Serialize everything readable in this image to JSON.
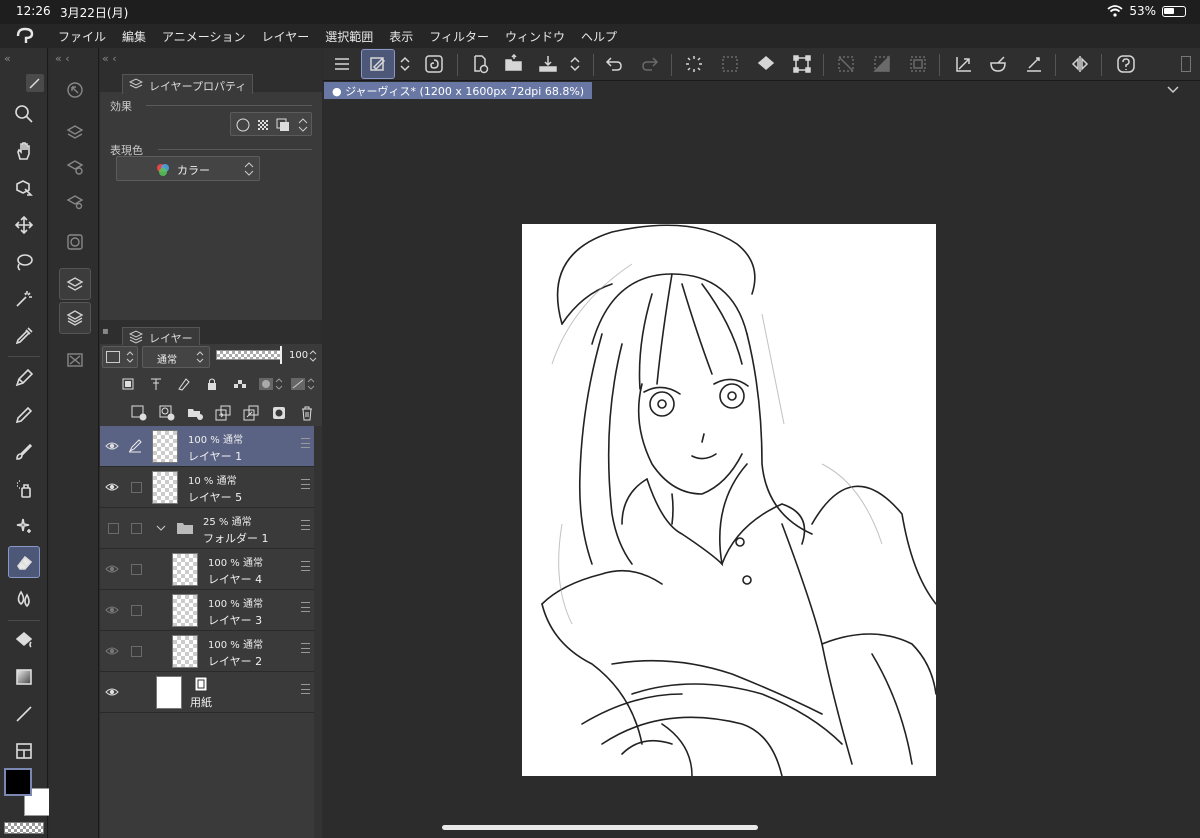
{
  "status": {
    "time": "12:26",
    "date": "3月22日(月)",
    "battery": "53%"
  },
  "menu": [
    "ファイル",
    "編集",
    "アニメーション",
    "レイヤー",
    "選択範囲",
    "表示",
    "フィルター",
    "ウィンドウ",
    "ヘルプ"
  ],
  "tools": [
    "zoom-icon",
    "hand-icon",
    "object-select-icon",
    "move-icon",
    "lasso-icon",
    "magic-wand-icon",
    "eyedropper-icon",
    "pen-icon",
    "pencil-icon",
    "brush-icon",
    "airbrush-icon",
    "decoration-icon",
    "eraser-icon",
    "blend-icon",
    "fill-icon",
    "gradient-icon",
    "line-icon",
    "frame-icon"
  ],
  "property_panel": {
    "tab_label": "レイヤープロパティ",
    "effect_label": "効果",
    "color_label": "表現色",
    "color_value": "カラー"
  },
  "layer_panel": {
    "tab_label": "レイヤー",
    "blend_mode": "通常",
    "opacity": "100",
    "layers": [
      {
        "opacity_mode": "100 % 通常",
        "name": "レイヤー 1",
        "selected": true,
        "indent": 0
      },
      {
        "opacity_mode": "10 % 通常",
        "name": "レイヤー 5",
        "selected": false,
        "indent": 0
      },
      {
        "opacity_mode": "25 % 通常",
        "name": "フォルダー 1",
        "selected": false,
        "indent": 0,
        "folder": true
      },
      {
        "opacity_mode": "100 % 通常",
        "name": "レイヤー 4",
        "selected": false,
        "indent": 1
      },
      {
        "opacity_mode": "100 % 通常",
        "name": "レイヤー 3",
        "selected": false,
        "indent": 1
      },
      {
        "opacity_mode": "100 % 通常",
        "name": "レイヤー 2",
        "selected": false,
        "indent": 1
      },
      {
        "opacity_mode": "",
        "name": "用紙",
        "selected": false,
        "indent": 0,
        "paper": true
      }
    ]
  },
  "document": {
    "tab_label": "ジャーヴィス* (1200 x 1600px 72dpi 68.8%)"
  },
  "colors": {
    "accent": "#5b6384",
    "tab": "#6877a3",
    "active_tool": "#4d5879"
  }
}
